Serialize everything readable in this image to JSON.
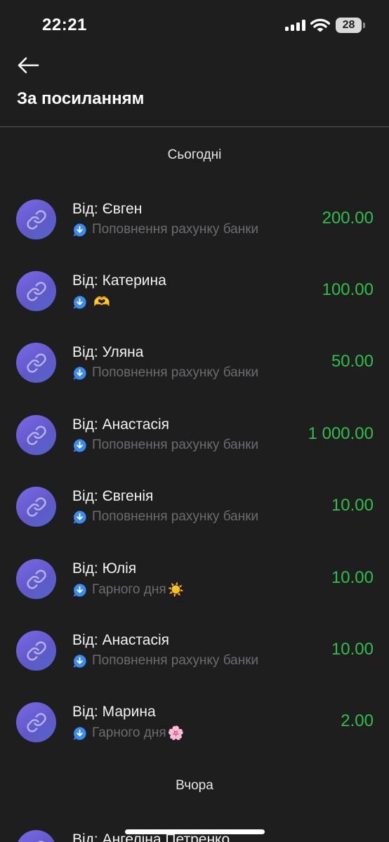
{
  "status_bar": {
    "time": "22:21",
    "battery": "28"
  },
  "header": {
    "title": "За посиланням"
  },
  "sections": [
    {
      "label": "Сьогодні",
      "items": [
        {
          "name": "Від: Євген",
          "comment": "Поповнення рахунку банки",
          "emoji": "",
          "amount": "200.00"
        },
        {
          "name": "Від: Катерина",
          "comment": "",
          "emoji": "🫶",
          "amount": "100.00"
        },
        {
          "name": "Від: Уляна",
          "comment": "Поповнення рахунку банки",
          "emoji": "",
          "amount": "50.00"
        },
        {
          "name": "Від: Анастасія",
          "comment": "Поповнення рахунку банки",
          "emoji": "",
          "amount": "1 000.00"
        },
        {
          "name": "Від: Євгенія",
          "comment": "Поповнення рахунку банки",
          "emoji": "",
          "amount": "10.00"
        },
        {
          "name": "Від: Юлія",
          "comment": "Гарного дня",
          "emoji": "☀️",
          "amount": "10.00"
        },
        {
          "name": "Від: Анастасія",
          "comment": "Поповнення рахунку банки",
          "emoji": "",
          "amount": "10.00"
        },
        {
          "name": "Від: Марина",
          "comment": "Гарного дня",
          "emoji": "🌸",
          "amount": "2.00"
        }
      ]
    },
    {
      "label": "Вчора",
      "items": [
        {
          "name": "Від: Ангеліна Петренко"
        }
      ]
    }
  ],
  "colors": {
    "background": "#1e1e1f",
    "amount_positive": "#2fbf4a",
    "avatar": "#6b5fd6",
    "message_icon": "#3b8cf0"
  },
  "icons": {
    "back": "arrow-left-icon",
    "avatar": "link-icon",
    "comment": "message-down-icon"
  }
}
